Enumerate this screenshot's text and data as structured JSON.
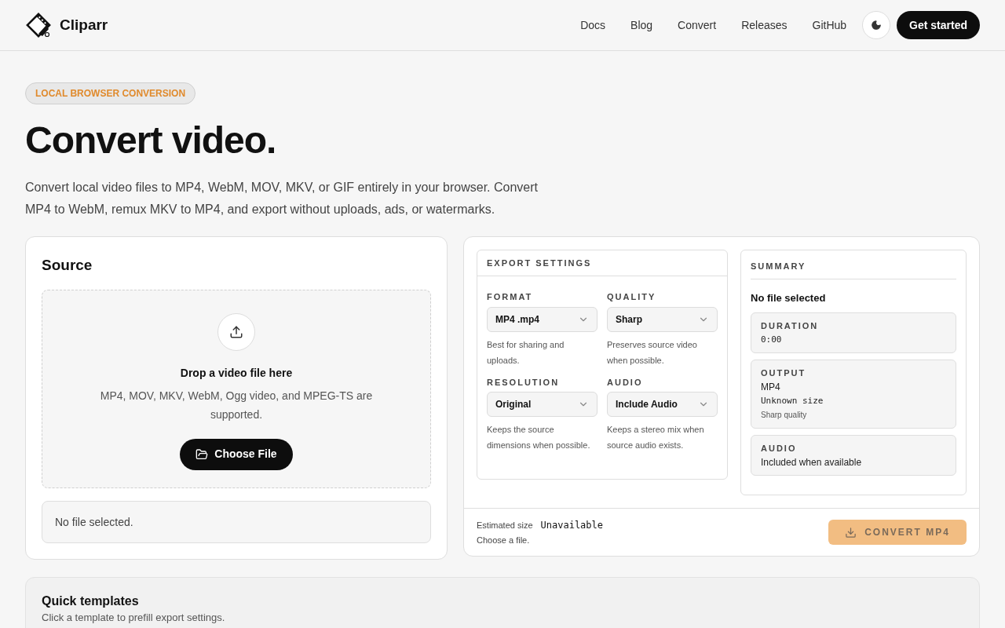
{
  "brand": {
    "name": "Cliparr"
  },
  "nav": {
    "links": [
      "Docs",
      "Blog",
      "Convert",
      "Releases",
      "GitHub"
    ],
    "cta": "Get started"
  },
  "hero": {
    "badge": "LOCAL BROWSER CONVERSION",
    "title": "Convert video.",
    "description": "Convert local video files to MP4, WebM, MOV, MKV, or GIF entirely in your browser. Convert MP4 to WebM, remux MKV to MP4, and export without uploads, ads, or watermarks."
  },
  "source": {
    "title": "Source",
    "drop_title": "Drop a video file here",
    "drop_hint": "MP4, MOV, MKV, WebM, Ogg video, and MPEG-TS are supported.",
    "button": "Choose File",
    "status": "No file selected."
  },
  "export_settings": {
    "title": "EXPORT SETTINGS",
    "fields": [
      {
        "label": "FORMAT",
        "value": "MP4 .mp4",
        "hint": "Best for sharing and uploads."
      },
      {
        "label": "QUALITY",
        "value": "Sharp",
        "hint": "Preserves source video when possible."
      },
      {
        "label": "RESOLUTION",
        "value": "Original",
        "hint": "Keeps the source dimensions when possible."
      },
      {
        "label": "AUDIO",
        "value": "Include Audio",
        "hint": "Keeps a stereo mix when source audio exists."
      }
    ]
  },
  "summary": {
    "title": "SUMMARY",
    "file": "No file selected",
    "items": [
      {
        "label": "DURATION",
        "lines": [
          {
            "text": "0:00",
            "kind": "mono"
          }
        ]
      },
      {
        "label": "OUTPUT",
        "lines": [
          {
            "text": "MP4",
            "kind": "plain"
          },
          {
            "text": "Unknown size",
            "kind": "mono"
          },
          {
            "text": "Sharp quality",
            "kind": "small"
          }
        ]
      },
      {
        "label": "AUDIO",
        "lines": [
          {
            "text": "Included when available",
            "kind": "plain"
          }
        ]
      }
    ]
  },
  "footer": {
    "estimate_label": "Estimated size",
    "estimate_value": "Unavailable",
    "note": "Choose a file.",
    "convert_button": {
      "label": "CONVERT MP4",
      "disabled": true
    }
  },
  "templates": {
    "title": "Quick templates",
    "description": "Click a template to prefill export settings."
  }
}
